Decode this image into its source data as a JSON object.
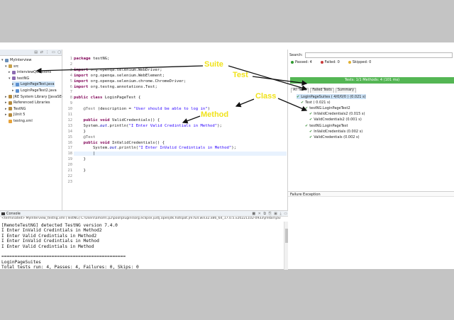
{
  "package_explorer": {
    "tree": [
      {
        "label": "MyInterview",
        "arrow": "v",
        "icon": "proj",
        "indent": 0
      },
      {
        "label": "src",
        "arrow": "v",
        "icon": "src",
        "indent": 1
      },
      {
        "label": "interviewQuestions",
        "arrow": ">",
        "icon": "pkg",
        "indent": 2
      },
      {
        "label": "testNG",
        "arrow": "v",
        "icon": "pkg",
        "indent": 2
      },
      {
        "label": "LoginPageTest.java",
        "arrow": ">",
        "icon": "java",
        "indent": 3,
        "selected": true
      },
      {
        "label": "LoginPageTest2.java",
        "arrow": ">",
        "icon": "java",
        "indent": 3
      },
      {
        "label": "JRE System Library [JavaSE-17]",
        "arrow": ">",
        "icon": "lib",
        "indent": 1
      },
      {
        "label": "Referenced Libraries",
        "arrow": ">",
        "icon": "lib",
        "indent": 1
      },
      {
        "label": "TestNG",
        "arrow": ">",
        "icon": "lib",
        "indent": 1
      },
      {
        "label": "JUnit 5",
        "arrow": ">",
        "icon": "lib",
        "indent": 1
      },
      {
        "label": "testng.xml",
        "arrow": "",
        "icon": "xml",
        "indent": 1
      }
    ]
  },
  "editor": {
    "lines": [
      {
        "n": "1",
        "html": "<span class='kw'>package</span> testNG;"
      },
      {
        "n": "2",
        "html": ""
      },
      {
        "n": "3",
        "html": "<span class='kw'>import</span> org.openqa.selenium.WebDriver;"
      },
      {
        "n": "4",
        "html": "<span class='kw'>import</span> org.openqa.selenium.WebElement;"
      },
      {
        "n": "5",
        "html": "<span class='kw'>import</span> org.openqa.selenium.chrome.ChromeDriver;"
      },
      {
        "n": "6",
        "html": "<span class='kw'>import</span> org.testng.annotations.Test;"
      },
      {
        "n": "7",
        "html": ""
      },
      {
        "n": "8",
        "html": "<span class='kw'>public class</span> LoginPageTest {"
      },
      {
        "n": "9",
        "html": ""
      },
      {
        "n": "10",
        "html": "    <span class='ann'>@Test</span> (description = <span class='str'>\"User should be able to log in\"</span>)"
      },
      {
        "n": "11",
        "html": ""
      },
      {
        "n": "12",
        "html": "    <span class='kw'>public void</span> ValidCredentials() {"
      },
      {
        "n": "13",
        "html": "    System.<span class='fld'>out</span>.println(<span class='str'>\"I Enter Valid Credintials in Method\"</span>);"
      },
      {
        "n": "14",
        "html": "    }"
      },
      {
        "n": "15",
        "html": "    <span class='ann'>@Test</span>"
      },
      {
        "n": "16",
        "html": "    <span class='kw'>public void</span> InValidCredentials() {"
      },
      {
        "n": "17",
        "html": "        System.<span class='fld'>out</span>.println(<span class='str'>\"I Enter InValid Credintials in Method\"</span>);"
      },
      {
        "n": "18",
        "html": "        |",
        "current": true
      },
      {
        "n": "19",
        "html": "    }"
      },
      {
        "n": "20",
        "html": ""
      },
      {
        "n": "21",
        "html": "    }"
      },
      {
        "n": "22",
        "html": ""
      },
      {
        "n": "23",
        "html": ""
      }
    ]
  },
  "testng": {
    "search_label": "Search:",
    "passed": "Passed: 4",
    "failed": "Failed: 0",
    "skipped": "Skipped: 0",
    "progress_text": "Tests: 1/1  Methods: 4 (101 ms)",
    "progress_fraction": 1.0,
    "tabs": [
      "All Tests",
      "Failed Tests",
      "Summary"
    ],
    "tree": [
      {
        "label": "LoginPageSuites ( 4/0/0/0 ) (0.021 s)",
        "indent": 0,
        "selected": true
      },
      {
        "label": "Test ( 0.021 s)",
        "indent": 1
      },
      {
        "label": "testNG.LoginPageTest2",
        "indent": 2
      },
      {
        "label": "InValidCredentials2   (0.015 s)",
        "indent": 3
      },
      {
        "label": "ValidCredentials2  (0.001 s)",
        "indent": 3
      },
      {
        "label": "testNG.LoginPageTest",
        "indent": 2
      },
      {
        "label": "InValidCredentials  (0.002 s)",
        "indent": 3
      },
      {
        "label": "ValidCredentials  (0.002 s)",
        "indent": 3
      }
    ],
    "failure_label": "Failure Exception"
  },
  "console": {
    "title": "Console",
    "terminated": "<terminated> MyInterview_testng.xml [TestNG] C:\\Users\\amom\\.p2\\pool\\plugins\\org.eclipse.justj.openjdk.hotspot.jre.full.win32.x86_64_17.0.5.v20221102-0933\\jre\\bin\\jav",
    "lines": [
      "[RemoteTestNG] detected TestNG version 7.4.0",
      "I Enter InValid Credintials in Method2",
      "I Enter Valid Credintials in Method2",
      "I Enter InValid Credintials in Method",
      "I Enter Valid Credintials in Method",
      "",
      "===============================================",
      "LoginPageSuites",
      "Total tests run: 4, Passes: 4, Failures: 0, Skips: 0"
    ]
  },
  "annotations": {
    "suite": "Suite",
    "test": "Test",
    "class": "Class",
    "method": "Method"
  }
}
